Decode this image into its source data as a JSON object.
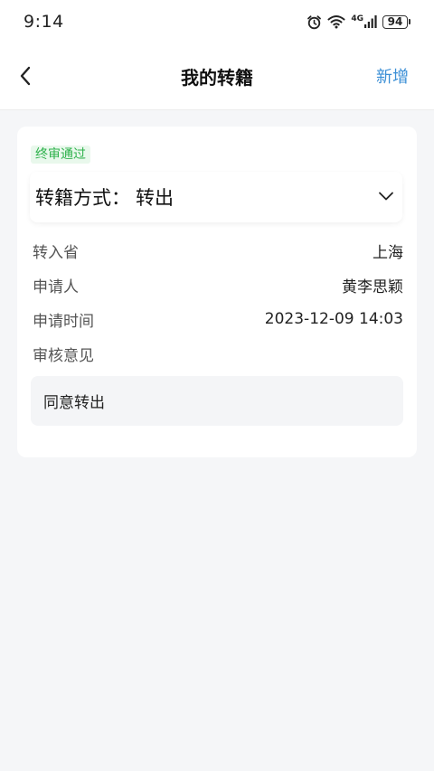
{
  "status_bar": {
    "time": "9:14",
    "network": "4G",
    "battery": "94"
  },
  "header": {
    "title": "我的转籍",
    "action_label": "新增"
  },
  "record": {
    "status_badge": "终审通过",
    "type_label": "转籍方式：",
    "type_value": "转出",
    "fields": [
      {
        "label": "转入省",
        "value": "上海"
      },
      {
        "label": "申请人",
        "value": "黄李思颖"
      },
      {
        "label": "申请时间",
        "value": "2023-12-09 14:03"
      }
    ],
    "opinion_label": "审核意见",
    "opinion_text": "同意转出"
  },
  "colors": {
    "accent": "#3b8fd6",
    "status_green": "#2fb24c",
    "status_green_bg": "#e9f8ec",
    "page_bg": "#f5f6f8"
  },
  "icons": [
    "alarm-icon",
    "wifi-icon",
    "signal-icon",
    "battery-icon",
    "back-arrow-icon",
    "chevron-down-icon"
  ]
}
